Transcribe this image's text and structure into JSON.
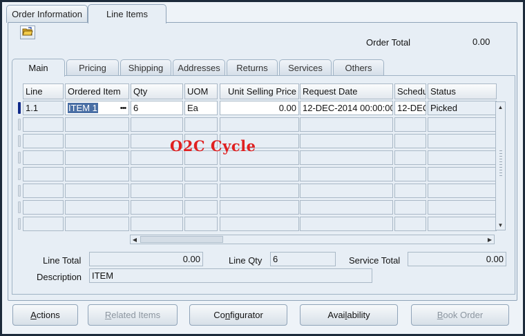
{
  "tabs": {
    "order_information": "Order Information",
    "line_items": "Line Items"
  },
  "header": {
    "order_total_label": "Order Total",
    "order_total_value": "0.00"
  },
  "sub_tabs": [
    "Main",
    "Pricing",
    "Shipping",
    "Addresses",
    "Returns",
    "Services",
    "Others"
  ],
  "grid": {
    "columns": [
      "Line",
      "Ordered Item",
      "Qty",
      "UOM",
      "Unit Selling Price",
      "Request Date",
      "Schedu",
      "Status"
    ],
    "rows": [
      {
        "line": "1.1",
        "ordered_item": "ITEM 1",
        "lov": "•••",
        "qty": "6",
        "uom": "Ea",
        "unit_selling_price": "0.00",
        "request_date": "12-DEC-2014 00:00:00",
        "schedule": "12-DEC",
        "status": "Picked"
      }
    ],
    "empty_row_count": 7
  },
  "overlay_text": "O2C Cycle",
  "summary": {
    "line_total_label": "Line Total",
    "line_total_value": "0.00",
    "line_qty_label": "Line Qty",
    "line_qty_value": "6",
    "service_total_label": "Service Total",
    "service_total_value": "0.00",
    "description_label": "Description",
    "description_value": "ITEM"
  },
  "buttons": {
    "actions": {
      "label": "Actions",
      "mnemonic": "A",
      "rest": "ctions"
    },
    "related_items": {
      "label": "Related Items",
      "mnemonic": "R",
      "rest": "elated Items"
    },
    "configurator": {
      "label": "Configurator",
      "pre": "Co",
      "mnemonic": "n",
      "rest": "figurator"
    },
    "availability": {
      "label": "Availability",
      "pre": "Avai",
      "mnemonic": "l",
      "rest": "ability"
    },
    "book_order": {
      "label": "Book Order",
      "mnemonic": "B",
      "rest": "ook Order"
    }
  },
  "icons": {
    "folder": "folder-open-icon",
    "scroll_up": "arrow-up-icon",
    "scroll_down": "arrow-down-icon",
    "scroll_left": "arrow-left-icon",
    "scroll_right": "arrow-right-icon"
  },
  "colors": {
    "current_row_marker": "#102a8a",
    "overlay_text": "#e02020",
    "selection": "#4a6fa5"
  }
}
